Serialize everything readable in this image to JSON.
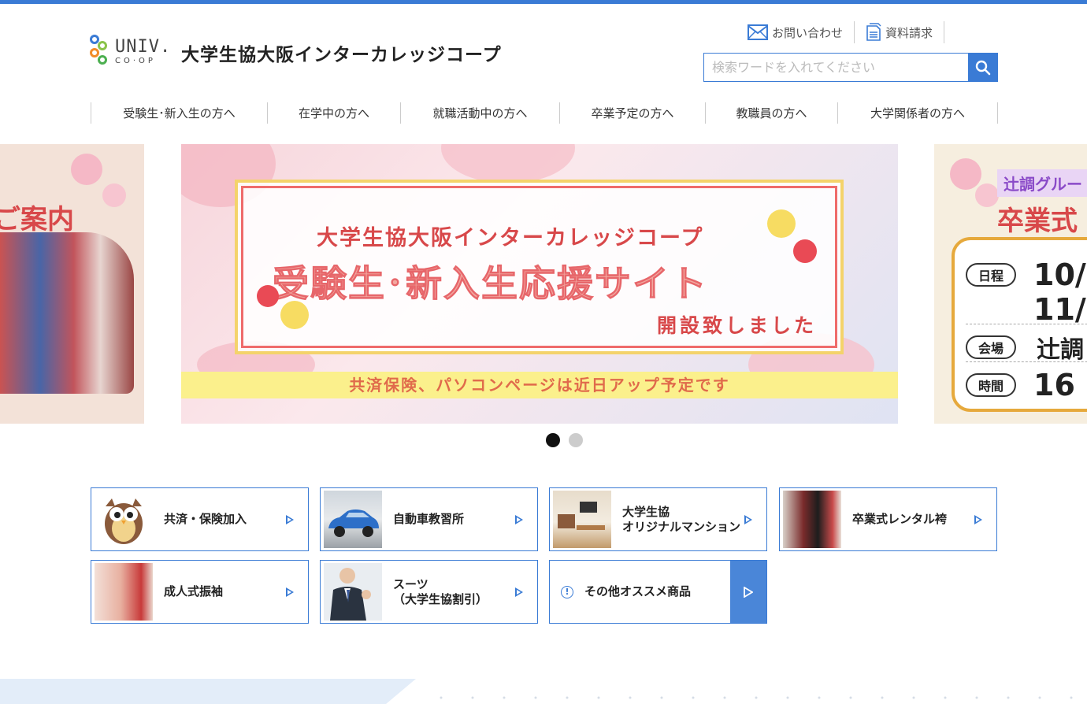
{
  "header": {
    "logo_univ": "UNIV.",
    "logo_coop": "CO·OP",
    "site_title": "大学生協大阪インターカレッジコープ",
    "contact_label": "お問い合わせ",
    "docs_label": "資料請求",
    "search_placeholder": "検索ワードを入れてください"
  },
  "nav": {
    "items": [
      {
        "label": "受験生･新入生の方へ"
      },
      {
        "label": "在学中の方へ"
      },
      {
        "label": "就職活動中の方へ"
      },
      {
        "label": "卒業予定の方へ"
      },
      {
        "label": "教職員の方へ"
      },
      {
        "label": "大学関係者の方へ"
      }
    ]
  },
  "slider": {
    "left": {
      "title": "ご案内"
    },
    "main": {
      "line1": "大学生協大阪インターカレッジコープ",
      "line2": "受験生･新入生応援サイト",
      "line3": "開設致しました",
      "strip": "共済保険、パソコンページは近日アップ予定です"
    },
    "right": {
      "tag": "辻調グルー",
      "title": "卒業式",
      "rows": [
        {
          "label": "日程",
          "value": "10/"
        },
        {
          "label": "",
          "value": "11/"
        },
        {
          "label": "会場",
          "value": "辻調"
        },
        {
          "label": "時間",
          "value": "16"
        }
      ]
    },
    "active_index": 0,
    "dot_count": 2
  },
  "cards": [
    {
      "label": "共済・保険加入",
      "icon": "owl-mascot"
    },
    {
      "label": "自動車教習所",
      "icon": "car-photo"
    },
    {
      "label": "大学生協\nオリジナルマンション",
      "icon": "room-photo"
    },
    {
      "label": "卒業式レンタル袴",
      "icon": "hakama-photo"
    },
    {
      "label": "成人式振袖",
      "icon": "furisode-photo"
    },
    {
      "label": "スーツ\n（大学生協割引）",
      "icon": "suit-photo"
    },
    {
      "label": "その他オススメ商品",
      "icon": "info-icon"
    }
  ],
  "colors": {
    "accent": "#3a7bd5",
    "title_red": "#d8484a",
    "strip_yellow": "#fbf08c"
  }
}
